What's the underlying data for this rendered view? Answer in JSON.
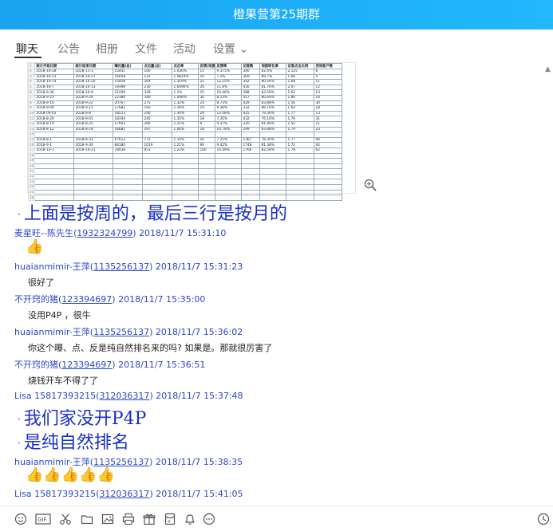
{
  "window": {
    "title": "橙果营第25期群"
  },
  "tabs": [
    {
      "label": "聊天"
    },
    {
      "label": "公告"
    },
    {
      "label": "相册"
    },
    {
      "label": "文件"
    },
    {
      "label": "活动"
    },
    {
      "label": "设置 ⌄"
    }
  ],
  "spreadsheet": {
    "headers": [
      "统计开始日期",
      "统计结束日期",
      "曝光量(总)",
      "点击量(总)",
      "点击率",
      "反馈(询盘)",
      "反馈率",
      "访客数",
      "询盘转化率",
      "访客点击比例",
      "咨询客户数"
    ],
    "rows": [
      [
        "2018-10-28",
        "2018-11-3",
        "15441",
        "160",
        "1.036%",
        "15",
        "9.375%",
        "340",
        "62.4%",
        "2.125",
        "6"
      ],
      [
        "2018-10-21",
        "2018-10-27",
        "16058",
        "122",
        "1.0824%",
        "16",
        "7.2%",
        "369",
        "89.7%",
        "1.66",
        "5"
      ],
      [
        "2018-10-14",
        "2018-10-20",
        "15458",
        "204",
        "1.319%",
        "25",
        "12.25%",
        "342",
        "80.56%",
        "1.68",
        "11"
      ],
      [
        "2018-10-7",
        "2018-10-13",
        "19398",
        "230",
        "1.6496%",
        "26",
        "11.8%",
        "456",
        "81.76%",
        "2.07",
        "12"
      ],
      [
        "2018-9-30",
        "2018-10-6",
        "21590",
        "339",
        "1.1%",
        "25",
        "10.46%",
        "388",
        "83.59%",
        "1.62",
        "13"
      ],
      [
        "2018-9-23",
        "2018-9-29",
        "22380",
        "340",
        "1.098%",
        "30",
        "8.13%",
        "457",
        "80.69%",
        "1.86",
        "24"
      ],
      [
        "2018-9-16",
        "2018-9-22",
        "20767",
        "275",
        "1.32%",
        "24",
        "8.73%",
        "429",
        "83.88%",
        "1.56",
        "30"
      ],
      [
        "2018-9-09",
        "2018-9-15",
        "17682",
        "193",
        "1.16%",
        "19",
        "9.36%",
        "332",
        "86.16%",
        "1.64",
        "18"
      ],
      [
        "2018-09-02",
        "2018-9-8",
        "18513",
        "240",
        "1.30%",
        "29",
        "12.08%",
        "425",
        "79.30%",
        "1.77",
        "13"
      ],
      [
        "2018-8-26",
        "2018-9-01",
        "18194",
        "245",
        "1.35%",
        "18",
        "7.35%",
        "432",
        "76.16%",
        "1.76",
        "31"
      ],
      [
        "2018-8-19",
        "2018-8-25",
        "17003",
        "206",
        "1.21%",
        "9",
        "4.37%",
        "320",
        "81.46%",
        "1.55",
        "11"
      ],
      [
        "2018-8-12",
        "2018-8-18",
        "16681",
        "167",
        "1.00%",
        "18",
        "10.78%",
        "299",
        "83.88%",
        "1.79",
        "23"
      ],
      [
        "",
        "",
        "",
        "",
        "",
        "",
        "",
        "",
        "",
        "",
        ""
      ],
      [
        "2018-8-1",
        "2018-8-31",
        "67613",
        "772",
        "1.14%",
        "56",
        "7.25%",
        "1367",
        "78.30%",
        "1.77",
        "90"
      ],
      [
        "2018-9-1",
        "2018-9-30",
        "84180",
        "1019",
        "1.21%",
        "96",
        "9.42%",
        "1748",
        "81.38%",
        "1.72",
        "92"
      ],
      [
        "2018-10-1",
        "2018-10-31",
        "78430",
        "953",
        "1.22%",
        "100",
        "10.49%",
        "1766",
        "82.59%",
        "1.79",
        "62"
      ],
      [
        "",
        "",
        "",
        "",
        "",
        "",
        "",
        "",
        "",
        "",
        ""
      ],
      [
        "",
        "",
        "",
        "",
        "",
        "",
        "",
        "",
        "",
        "",
        ""
      ],
      [
        "",
        "",
        "",
        "",
        "",
        "",
        "",
        "",
        "",
        "",
        ""
      ],
      [
        "",
        "",
        "",
        "",
        "",
        "",
        "",
        "",
        "",
        "",
        ""
      ],
      [
        "",
        "",
        "",
        "",
        "",
        "",
        "",
        "",
        "",
        "",
        ""
      ],
      [
        "",
        "",
        "",
        "",
        "",
        "",
        "",
        "",
        "",
        "",
        ""
      ],
      [
        "",
        "",
        "",
        "",
        "",
        "",
        "",
        "",
        "",
        "",
        ""
      ],
      [
        "",
        "",
        "",
        "",
        "",
        "",
        "",
        "",
        "",
        "",
        ""
      ],
      [
        "",
        "",
        "",
        "",
        "",
        "",
        "",
        "",
        "",
        "",
        ""
      ]
    ]
  },
  "messages": [
    {
      "big_text": "上面是按周的，最后三行是按月的"
    },
    {
      "sender": "麦星旺--陈先生",
      "qq": "1932324799",
      "time": "2018/11/7 15:31:10",
      "thumbs": "👍"
    },
    {
      "sender": "huaianmimir-王萍",
      "qq": "1135256137",
      "time": "2018/11/7 15:31:23",
      "text": "很好了"
    },
    {
      "sender": "不开窍的猪",
      "qq": "123394697",
      "time": "2018/11/7 15:35:00",
      "text": "没用P4P ，很牛"
    },
    {
      "sender": "huaianmimir-王萍",
      "qq": "1135256137",
      "time": "2018/11/7 15:36:02",
      "text": "你这个曝、点、反是纯自然排名来的吗? 如果是。那就很厉害了"
    },
    {
      "sender": "不开窍的猪",
      "qq": "123394697",
      "time": "2018/11/7 15:36:51",
      "text": "烧钱开车不得了了"
    },
    {
      "sender": "Lisa 15817393215",
      "qq": "312036317",
      "time": "2018/11/7 15:37:48",
      "big_lines": [
        "我们家没开P4P",
        "是纯自然排名"
      ]
    },
    {
      "sender": "huaianmimir-王萍",
      "qq": "1135256137",
      "time": "2018/11/7 15:38:35",
      "thumbs": "👍👍👍👍👍"
    },
    {
      "sender": "Lisa 15817393215",
      "qq": "312036317",
      "time": "2018/11/7 15:41:05"
    }
  ],
  "toolbar": {
    "icons": [
      "emoji-icon",
      "gif-icon",
      "scissors-icon",
      "folder-icon",
      "image-icon",
      "print-icon",
      "gift-icon",
      "red-packet-icon",
      "bell-icon",
      "more-icon",
      "history-icon"
    ]
  }
}
